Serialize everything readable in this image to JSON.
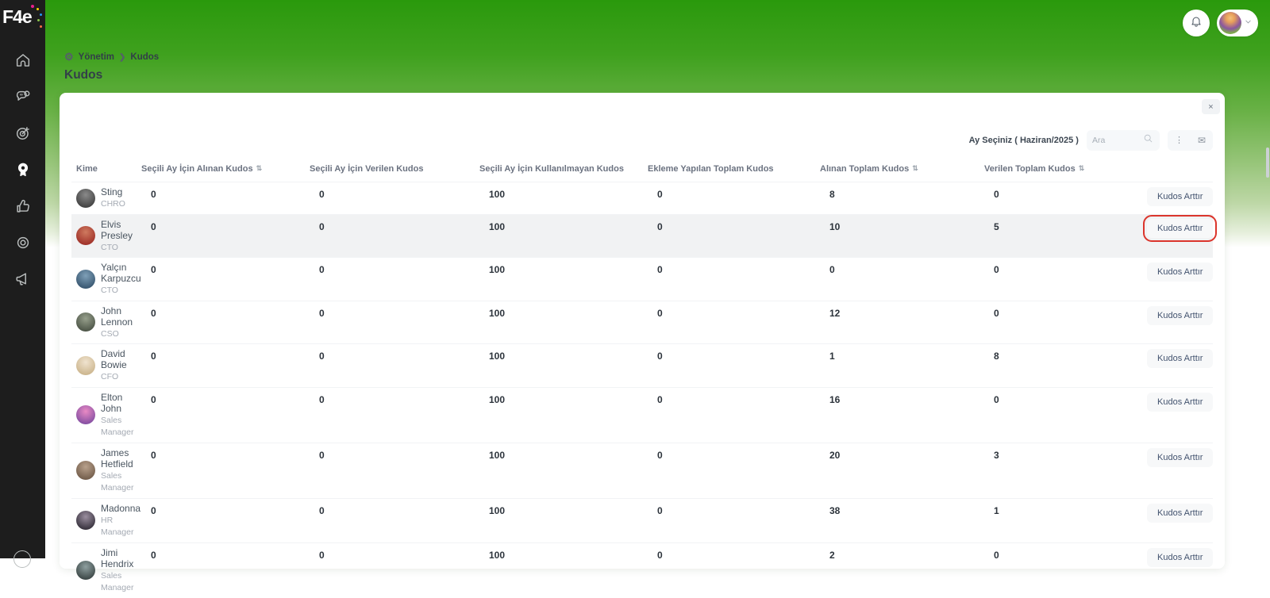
{
  "brand": {
    "logo": "F4e"
  },
  "sidebar": {
    "items": [
      {
        "name": "home",
        "active": false
      },
      {
        "name": "chat",
        "active": false
      },
      {
        "name": "target",
        "active": false
      },
      {
        "name": "medal",
        "active": true
      },
      {
        "name": "thumbs-up",
        "active": false
      },
      {
        "name": "seal",
        "active": false
      },
      {
        "name": "megaphone",
        "active": false
      }
    ]
  },
  "topbar": {
    "bell_icon": "bell",
    "profile_chevron": "chevron-down"
  },
  "breadcrumb": {
    "section": "Yönetim",
    "page": "Kudos",
    "gear_glyph": "⚙",
    "separator": "❯"
  },
  "page_title": "Kudos",
  "card": {
    "close_glyph": "×",
    "filter": {
      "month_label": "Ay Seçiniz ( Haziran/2025 )",
      "search_placeholder": "Ara",
      "more_glyph": "⋮",
      "export_glyph": "✉"
    },
    "table": {
      "sort_glyph": "⇅",
      "action_label": "Kudos Arttır",
      "columns": [
        {
          "label": "Kime",
          "sortable": false
        },
        {
          "label": "Seçili Ay İçin Alınan Kudos",
          "sortable": true
        },
        {
          "label": "Seçili Ay İçin Verilen Kudos",
          "sortable": false
        },
        {
          "label": "Seçili Ay İçin Kullanılmayan Kudos",
          "sortable": false
        },
        {
          "label": "Ekleme Yapılan Toplam Kudos",
          "sortable": false
        },
        {
          "label": "Alınan Toplam Kudos",
          "sortable": true
        },
        {
          "label": "Verilen Toplam Kudos",
          "sortable": true
        }
      ],
      "rows": [
        {
          "name": "Sting",
          "role": "CHRO",
          "values": [
            "0",
            "0",
            "100",
            "0",
            "8",
            "0"
          ],
          "selected": false,
          "action_highlighted": false,
          "avatar_top": "#8a8a8a",
          "avatar_bottom": "#3c3c3c"
        },
        {
          "name": "Elvis Presley",
          "role": "CTO",
          "values": [
            "0",
            "0",
            "100",
            "0",
            "10",
            "5"
          ],
          "selected": true,
          "action_highlighted": true,
          "avatar_top": "#cf7a5f",
          "avatar_bottom": "#9c2b25"
        },
        {
          "name": "Yalçın Karpuzcu",
          "role": "CTO",
          "values": [
            "0",
            "0",
            "100",
            "0",
            "0",
            "0"
          ],
          "selected": false,
          "action_highlighted": false,
          "avatar_top": "#7fa0b8",
          "avatar_bottom": "#33516b"
        },
        {
          "name": "John Lennon",
          "role": "CSO",
          "values": [
            "0",
            "0",
            "100",
            "0",
            "12",
            "0"
          ],
          "selected": false,
          "action_highlighted": false,
          "avatar_top": "#97a08c",
          "avatar_bottom": "#474f42"
        },
        {
          "name": "David Bowie",
          "role": "CFO",
          "values": [
            "0",
            "0",
            "100",
            "0",
            "1",
            "8"
          ],
          "selected": false,
          "action_highlighted": false,
          "avatar_top": "#f0e3cf",
          "avatar_bottom": "#c9b289"
        },
        {
          "name": "Elton John",
          "role": "Sales Manager",
          "values": [
            "0",
            "0",
            "100",
            "0",
            "16",
            "0"
          ],
          "selected": false,
          "action_highlighted": false,
          "avatar_top": "#e98ac4",
          "avatar_bottom": "#7d4ba0"
        },
        {
          "name": "James Hetfield",
          "role": "Sales Manager",
          "values": [
            "0",
            "0",
            "100",
            "0",
            "20",
            "3"
          ],
          "selected": false,
          "action_highlighted": false,
          "avatar_top": "#b9a18c",
          "avatar_bottom": "#6d5846"
        },
        {
          "name": "Madonna",
          "role": "HR Manager",
          "values": [
            "0",
            "0",
            "100",
            "0",
            "38",
            "1"
          ],
          "selected": false,
          "action_highlighted": false,
          "avatar_top": "#9b8fa0",
          "avatar_bottom": "#2f2a35"
        },
        {
          "name": "Jimi Hendrix",
          "role": "Sales Manager",
          "values": [
            "0",
            "0",
            "100",
            "0",
            "2",
            "0"
          ],
          "selected": false,
          "action_highlighted": false,
          "avatar_top": "#8fa0a0",
          "avatar_bottom": "#35403f"
        }
      ]
    }
  },
  "colors": {
    "accent_green": "#2a990c",
    "sidebar_bg": "#1d1d1d",
    "highlight_red": "#db352c",
    "selected_row_bg": "#f1f2f3"
  }
}
